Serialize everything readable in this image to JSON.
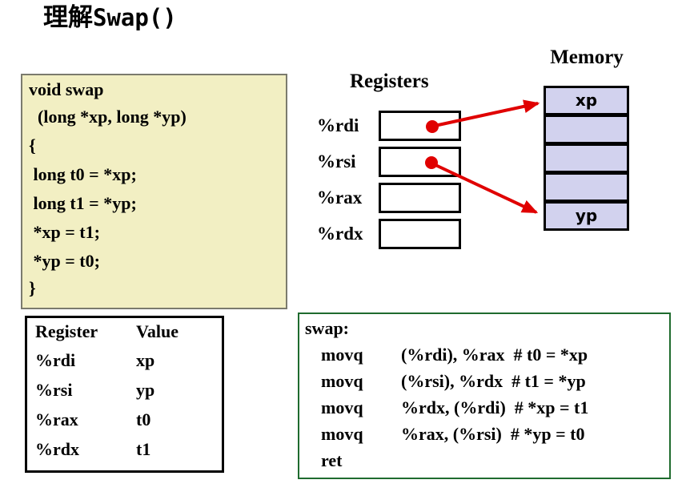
{
  "slide": {
    "title_cjk": "理解",
    "title_mono": "Swap()"
  },
  "c_code": {
    "lines": [
      "void swap",
      "  (long *xp, long *yp)",
      "{",
      " long t0 = *xp;",
      " long t1 = *yp;",
      " *xp = t1;",
      " *yp = t0;",
      "}"
    ],
    "background_color": "#f2efc3",
    "border_color": "#7b7b6e"
  },
  "register_table": {
    "headers": [
      "Register",
      "Value"
    ],
    "rows": [
      [
        "%rdi",
        "xp"
      ],
      [
        "%rsi",
        "yp"
      ],
      [
        "%rax",
        "t0"
      ],
      [
        "%rdx",
        "t1"
      ]
    ]
  },
  "diagram": {
    "registers_heading": "Registers",
    "memory_heading": "Memory",
    "register_labels": [
      "%rdi",
      "%rsi",
      "%rax",
      "%rdx"
    ],
    "memory_cells": [
      "xp",
      "",
      "",
      "",
      "yp"
    ],
    "memory_cell_color": "#d2d2ee",
    "pointer_color": "#e00000",
    "pointers": [
      {
        "from_register": "%rdi",
        "to_cell": "xp"
      },
      {
        "from_register": "%rsi",
        "to_cell": "yp"
      }
    ]
  },
  "assembly": {
    "border_color": "#1f6b2e",
    "lines": [
      {
        "label": "swap:",
        "mnemonic": "",
        "operands": ""
      },
      {
        "label": "",
        "mnemonic": "movq",
        "operands": "(%rdi), %rax  # t0 = *xp"
      },
      {
        "label": "",
        "mnemonic": "movq",
        "operands": "(%rsi), %rdx  # t1 = *yp"
      },
      {
        "label": "",
        "mnemonic": "movq",
        "operands": "%rdx, (%rdi)  # *xp = t1"
      },
      {
        "label": "",
        "mnemonic": "movq",
        "operands": "%rax, (%rsi)  # *yp = t0"
      },
      {
        "label": "",
        "mnemonic": "ret",
        "operands": ""
      }
    ]
  }
}
